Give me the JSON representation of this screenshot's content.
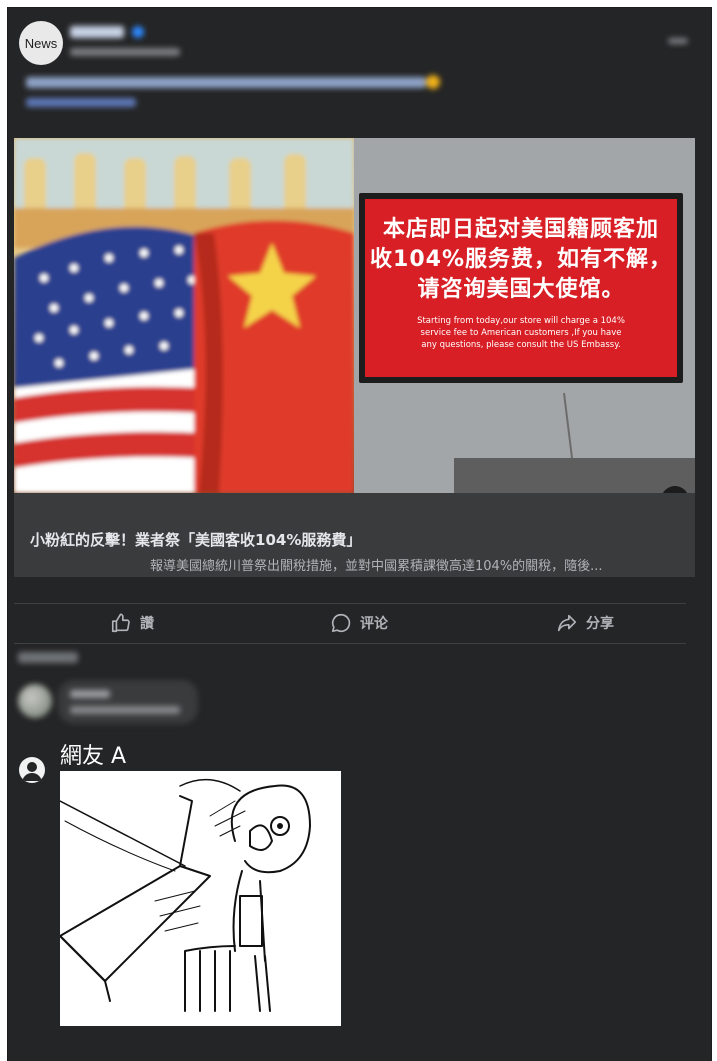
{
  "post": {
    "avatar_text": "News"
  },
  "link_preview": {
    "title": "小粉紅的反擊！業者祭「美國客收104%服務費」",
    "description": "報導美國總統川普祭出關稅措施，並對中國累積課徵高達104%的關稅，隨後..."
  },
  "sign": {
    "zh_lines": [
      "本店即日起对美国籍顾客加",
      "收104%服务费，如有不解，",
      "请咨询美国大使馆。"
    ],
    "en_lines": [
      "Starting from today,our store will charge a 104%",
      "service fee to American customers ,If you have",
      "any questions, please consult the US Embassy."
    ]
  },
  "info_icon_text": "i",
  "actions": [
    {
      "label": "讚",
      "icon": "thumbs-up-icon"
    },
    {
      "label": "评论",
      "icon": "comment-icon"
    },
    {
      "label": "分享",
      "icon": "share-icon"
    }
  ],
  "reply": {
    "user": "網友 A",
    "icon": "user-circle-icon",
    "image": "table-flip-meme"
  }
}
